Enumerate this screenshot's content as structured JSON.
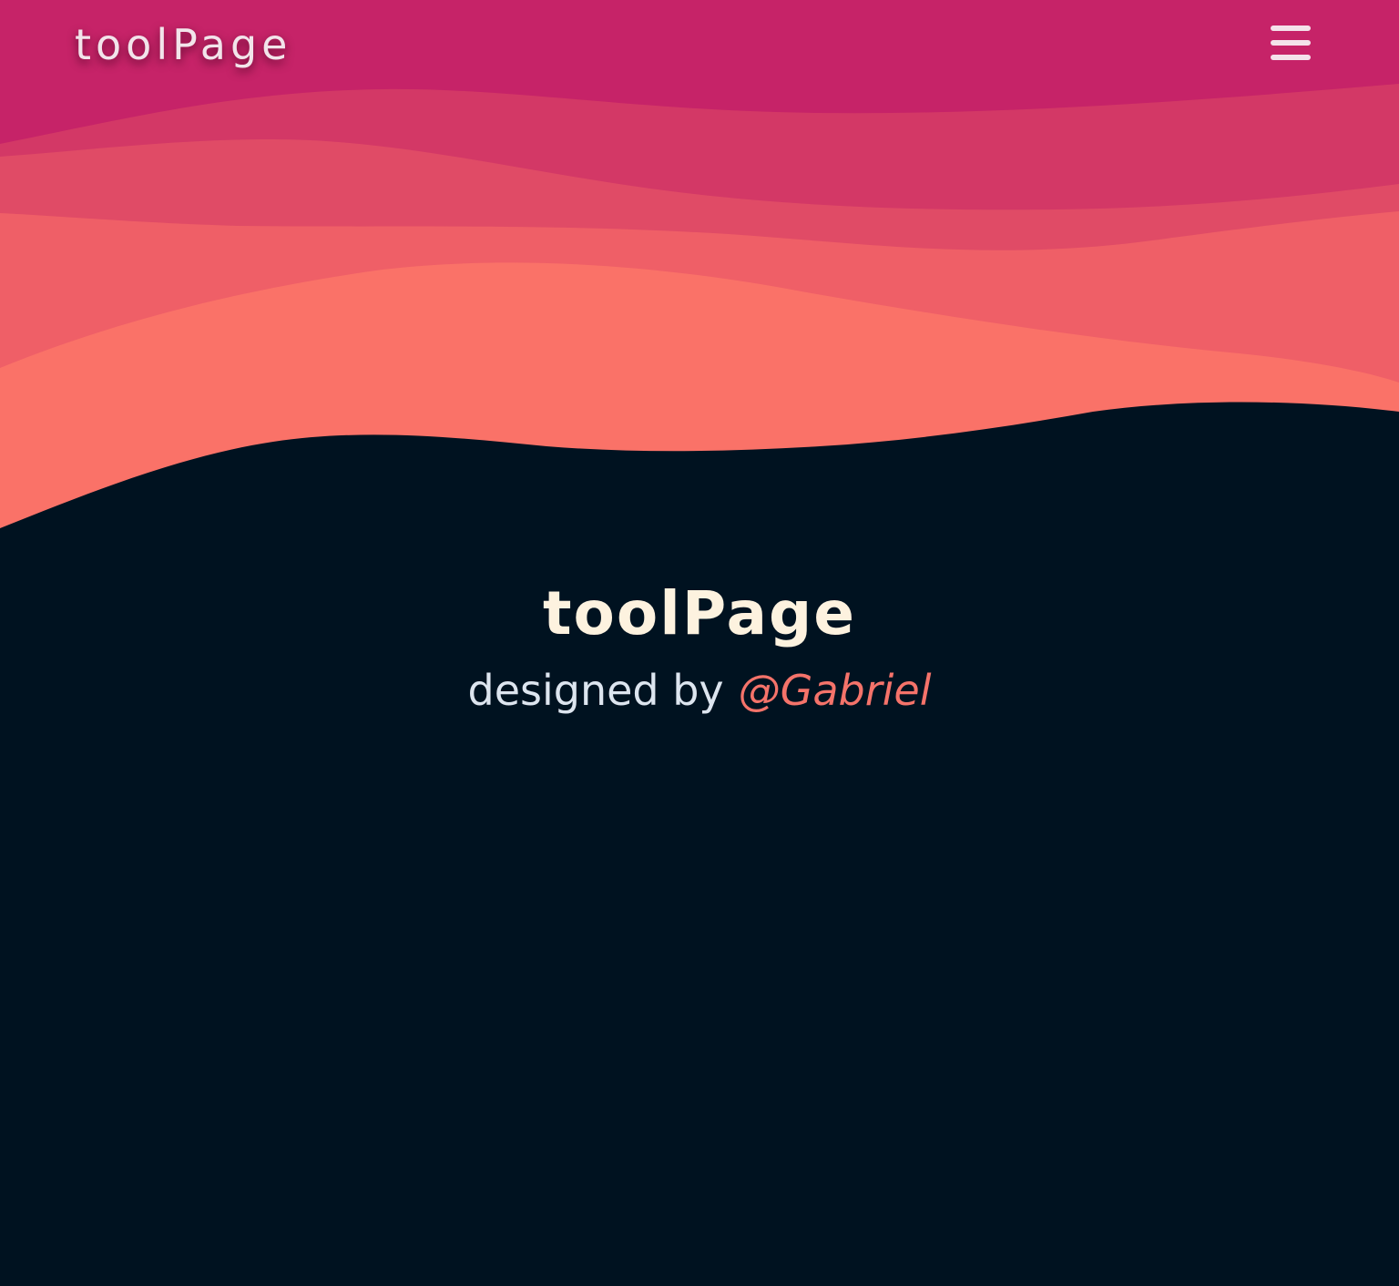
{
  "navbar": {
    "brand": "toolPage",
    "menu_icon": "hamburger-menu-icon"
  },
  "hero": {
    "title": "toolPage",
    "credit_prefix": "designed by",
    "credit_author": "@Gabriel"
  },
  "colors": {
    "background": "#001220",
    "wave_1": "#c62368",
    "wave_2": "#d33866",
    "wave_3": "#e04b66",
    "wave_4": "#ef5f67",
    "wave_5": "#fa7268",
    "brand_text": "#f2e4ea",
    "hero_title": "#fdf2df",
    "hero_credit": "#dde5ef",
    "accent": "#f5736a"
  }
}
